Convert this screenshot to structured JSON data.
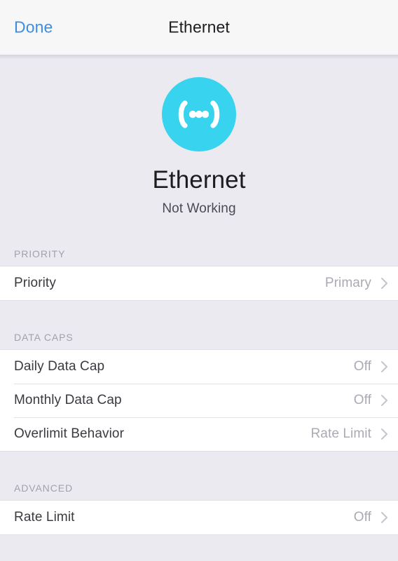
{
  "navbar": {
    "done_label": "Done",
    "title": "Ethernet"
  },
  "hero": {
    "icon_name": "ethernet-broadcast-icon",
    "name": "Ethernet",
    "status": "Not Working",
    "icon_color": "#38d3ee"
  },
  "sections": [
    {
      "header": "PRIORITY",
      "rows": [
        {
          "label": "Priority",
          "value": "Primary"
        }
      ]
    },
    {
      "header": "DATA CAPS",
      "rows": [
        {
          "label": "Daily Data Cap",
          "value": "Off"
        },
        {
          "label": "Monthly Data Cap",
          "value": "Off"
        },
        {
          "label": "Overlimit Behavior",
          "value": "Rate Limit"
        }
      ]
    },
    {
      "header": "ADVANCED",
      "rows": [
        {
          "label": "Rate Limit",
          "value": "Off"
        }
      ]
    }
  ],
  "colors": {
    "accent_link": "#3e8ee0",
    "background": "#eceaf1",
    "row_background": "#ffffff",
    "value_text": "#aba9b3"
  }
}
